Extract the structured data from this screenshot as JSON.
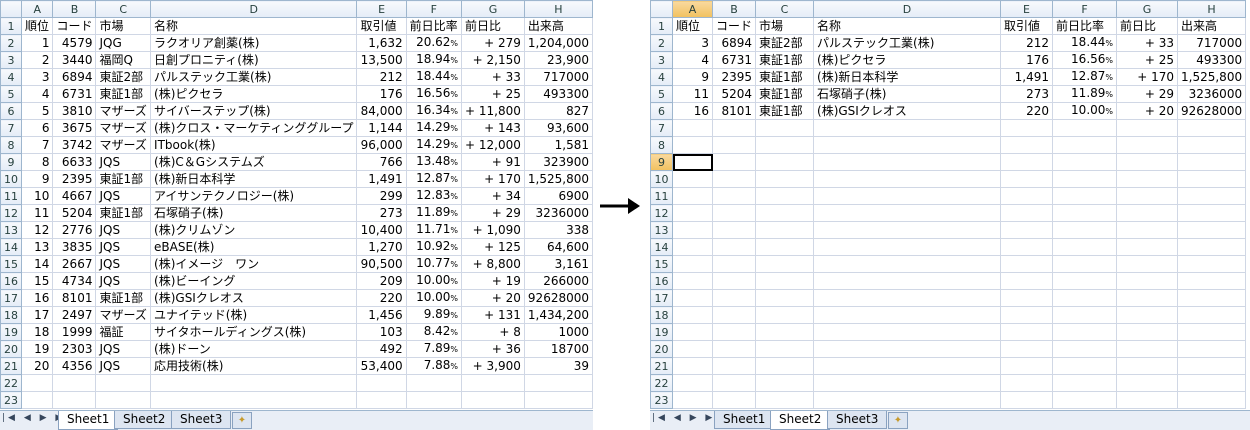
{
  "columns": [
    "A",
    "B",
    "C",
    "D",
    "E",
    "F",
    "G",
    "H"
  ],
  "rows_visible": 23,
  "left": {
    "header": [
      "順位",
      "コード",
      "市場",
      "名称",
      "取引値",
      "前日比率",
      "前日比",
      "出来高"
    ],
    "rows": [
      [
        "1",
        "4579",
        "JQG",
        "ラクオリア創薬(株)",
        "1,632",
        "20.62%",
        "+ 279",
        "1,204,000"
      ],
      [
        "2",
        "3440",
        "福岡Q",
        "日創プロニティ(株)",
        "13,500",
        "18.94%",
        "+ 2,150",
        "23,900"
      ],
      [
        "3",
        "6894",
        "東証2部",
        "パルステック工業(株)",
        "212",
        "18.44%",
        "+ 33",
        "717000"
      ],
      [
        "4",
        "6731",
        "東証1部",
        "(株)ピクセラ",
        "176",
        "16.56%",
        "+ 25",
        "493300"
      ],
      [
        "5",
        "3810",
        "マザーズ",
        "サイバーステップ(株)",
        "84,000",
        "16.34%",
        "+ 11,800",
        "827"
      ],
      [
        "6",
        "3675",
        "マザーズ",
        "(株)クロス・マーケティンググループ",
        "1,144",
        "14.29%",
        "+ 143",
        "93,600"
      ],
      [
        "7",
        "3742",
        "マザーズ",
        "ITbook(株)",
        "96,000",
        "14.29%",
        "+ 12,000",
        "1,581"
      ],
      [
        "8",
        "6633",
        "JQS",
        "(株)C＆Gシステムズ",
        "766",
        "13.48%",
        "+ 91",
        "323900"
      ],
      [
        "9",
        "2395",
        "東証1部",
        "(株)新日本科学",
        "1,491",
        "12.87%",
        "+ 170",
        "1,525,800"
      ],
      [
        "10",
        "4667",
        "JQS",
        "アイサンテクノロジー(株)",
        "299",
        "12.83%",
        "+ 34",
        "6900"
      ],
      [
        "11",
        "5204",
        "東証1部",
        "石塚硝子(株)",
        "273",
        "11.89%",
        "+ 29",
        "3236000"
      ],
      [
        "12",
        "2776",
        "JQS",
        "(株)クリムゾン",
        "10,400",
        "11.71%",
        "+ 1,090",
        "338"
      ],
      [
        "13",
        "3835",
        "JQS",
        "eBASE(株)",
        "1,270",
        "10.92%",
        "+ 125",
        "64,600"
      ],
      [
        "14",
        "2667",
        "JQS",
        "(株)イメージ　ワン",
        "90,500",
        "10.77%",
        "+ 8,800",
        "3,161"
      ],
      [
        "15",
        "4734",
        "JQS",
        "(株)ビーイング",
        "209",
        "10.00%",
        "+ 19",
        "266000"
      ],
      [
        "16",
        "8101",
        "東証1部",
        "(株)GSIクレオス",
        "220",
        "10.00%",
        "+ 20",
        "92628000"
      ],
      [
        "17",
        "2497",
        "マザーズ",
        "ユナイテッド(株)",
        "1,456",
        "9.89%",
        "+ 131",
        "1,434,200"
      ],
      [
        "18",
        "1999",
        "福証",
        "サイタホールディングス(株)",
        "103",
        "8.42%",
        "+ 8",
        "1000"
      ],
      [
        "19",
        "2303",
        "JQS",
        "(株)ドーン",
        "492",
        "7.89%",
        "+ 36",
        "18700"
      ],
      [
        "20",
        "4356",
        "JQS",
        "応用技術(株)",
        "53,400",
        "7.88%",
        "+ 3,900",
        "39"
      ]
    ],
    "tabs": [
      "Sheet1",
      "Sheet2",
      "Sheet3"
    ],
    "active_tab": 0
  },
  "right": {
    "header": [
      "順位",
      "コード",
      "市場",
      "名称",
      "取引値",
      "前日比率",
      "前日比",
      "出来高"
    ],
    "rows": [
      [
        "3",
        "6894",
        "東証2部",
        "パルステック工業(株)",
        "212",
        "18.44%",
        "+ 33",
        "717000"
      ],
      [
        "4",
        "6731",
        "東証1部",
        "(株)ピクセラ",
        "176",
        "16.56%",
        "+ 25",
        "493300"
      ],
      [
        "9",
        "2395",
        "東証1部",
        "(株)新日本科学",
        "1,491",
        "12.87%",
        "+ 170",
        "1,525,800"
      ],
      [
        "11",
        "5204",
        "東証1部",
        "石塚硝子(株)",
        "273",
        "11.89%",
        "+ 29",
        "3236000"
      ],
      [
        "16",
        "8101",
        "東証1部",
        "(株)GSIクレオス",
        "220",
        "10.00%",
        "+ 20",
        "92628000"
      ]
    ],
    "tabs": [
      "Sheet1",
      "Sheet2",
      "Sheet3"
    ],
    "active_tab": 1,
    "selected_cell": "A9",
    "rows_visible": 23
  },
  "colors": {
    "grid": "#d0d7e5",
    "header_bg": "#e4ecf7",
    "selected_header": "#f1c15f"
  }
}
